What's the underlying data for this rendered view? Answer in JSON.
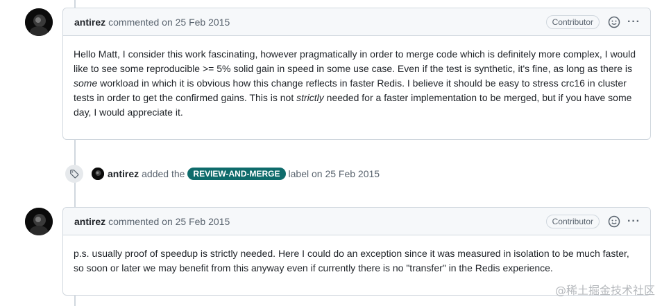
{
  "comments": [
    {
      "author": "antirez",
      "meta": "commented on 25 Feb 2015",
      "badge": "Contributor",
      "more": "···",
      "paragraph": [
        {
          "text": "Hello Matt, I consider this work fascinating, however pragmatically in order to merge code which is definitely more complex, I would like to see some reproducible >= 5% solid gain in speed in some use case. Even if the test is synthetic, it's fine, as long as there is "
        },
        {
          "text": "some",
          "em": true
        },
        {
          "text": " workload in which it is obvious how this change reflects in faster Redis. I believe it should be easy to stress crc16 in cluster tests in order to get the confirmed gains. This is not "
        },
        {
          "text": "strictly",
          "em": true
        },
        {
          "text": " needed for a faster implementation to be merged, but if you have some day, I would appreciate it."
        }
      ]
    },
    {
      "author": "antirez",
      "meta": "commented on 25 Feb 2015",
      "badge": "Contributor",
      "more": "···",
      "paragraph": [
        {
          "text": "p.s. usually proof of speedup is strictly needed. Here I could do an exception since it was measured in isolation to be much faster, so soon or later we may benefit from this anyway even if currently there is no \"transfer\" in the Redis experience."
        }
      ]
    }
  ],
  "event": {
    "author": "antirez",
    "action": "added the",
    "label": "REVIEW-AND-MERGE",
    "suffix": "label on 25 Feb 2015",
    "label_color": "#0e6b6b"
  },
  "watermark": "@稀土掘金技术社区"
}
